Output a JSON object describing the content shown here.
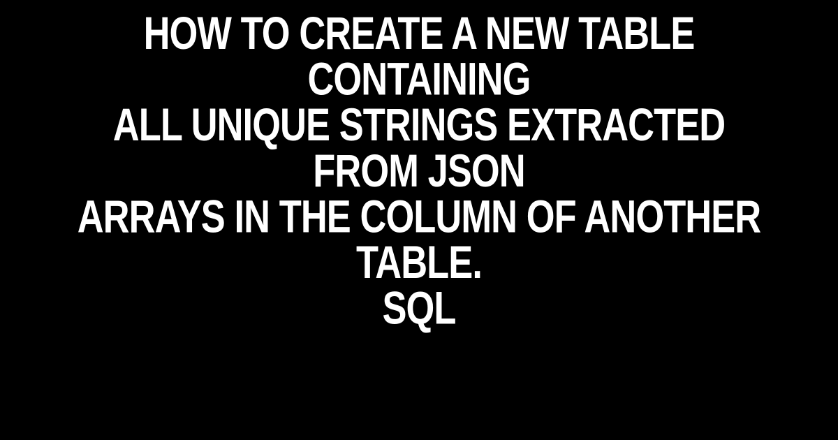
{
  "heading": {
    "text": "How to create a new table containing\nall unique Strings extracted from JSON\nArrays in the column of another table.\nSQL"
  }
}
